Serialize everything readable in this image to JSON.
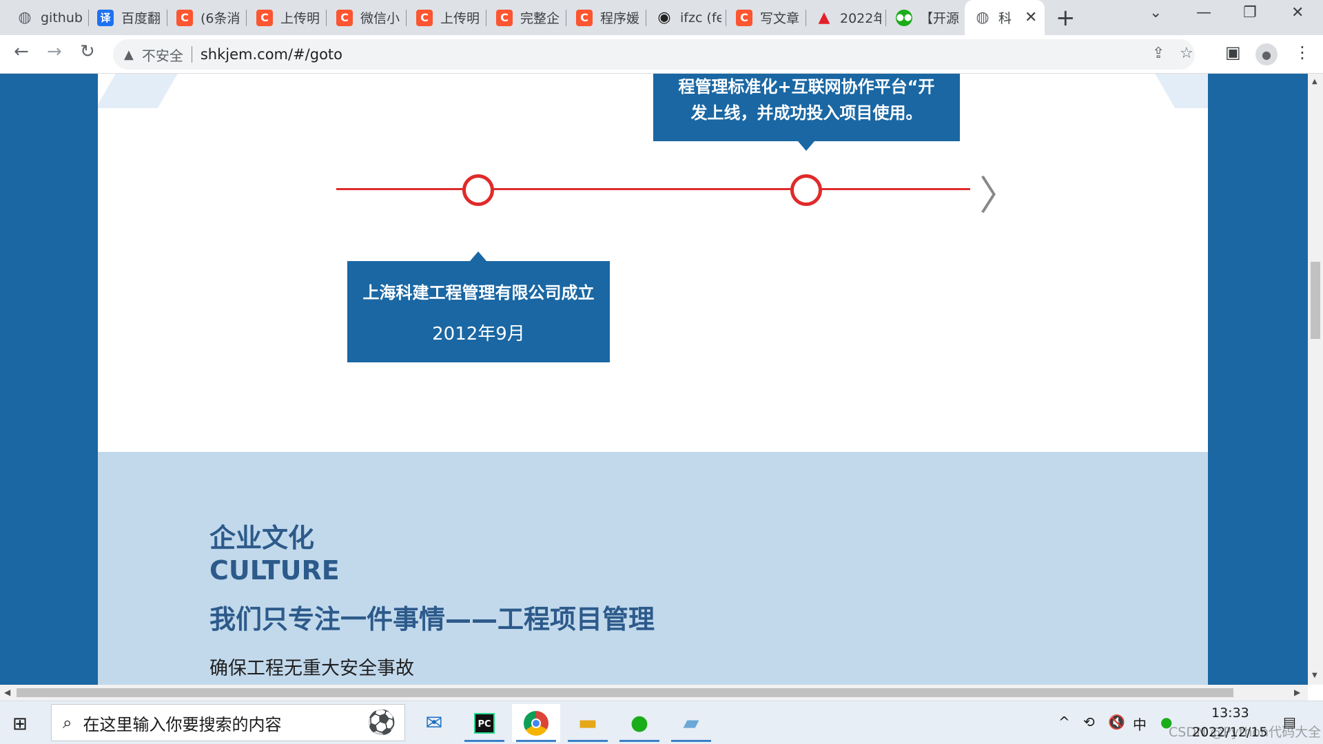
{
  "browser": {
    "tabs": [
      {
        "icon": "globe-icon",
        "glyph": "◍",
        "title": "github"
      },
      {
        "icon": "translate-icon",
        "glyph": "译",
        "title": "百度翻"
      },
      {
        "icon": "csdn-icon",
        "glyph": "C",
        "title": "(6条消"
      },
      {
        "icon": "csdn-icon",
        "glyph": "C",
        "title": "上传明"
      },
      {
        "icon": "csdn-icon",
        "glyph": "C",
        "title": "微信小"
      },
      {
        "icon": "csdn-icon",
        "glyph": "C",
        "title": "上传明"
      },
      {
        "icon": "csdn-icon",
        "glyph": "C",
        "title": "完整企"
      },
      {
        "icon": "csdn-icon",
        "glyph": "C",
        "title": "程序媛"
      },
      {
        "icon": "github-icon",
        "glyph": "◉",
        "title": "ifzc (fe"
      },
      {
        "icon": "csdn-icon",
        "glyph": "C",
        "title": "写文章"
      },
      {
        "icon": "adobe-icon",
        "glyph": "▲",
        "title": "2022年"
      },
      {
        "icon": "wechat-icon",
        "glyph": "●●",
        "title": "【开源"
      },
      {
        "icon": "globe-icon",
        "glyph": "◍",
        "title": "科"
      }
    ],
    "active_tab_index": 12,
    "new_tab_glyph": "+",
    "window_controls": {
      "dropdown": "⌄",
      "minimize": "—",
      "restore": "❐",
      "close": "✕"
    },
    "nav": {
      "back": "←",
      "forward": "→",
      "reload": "↻"
    },
    "security_label": "不安全",
    "url": "shkjem.com/#/goto"
  },
  "timeline": {
    "top_event": "程管理标准化+互联网协作平台“开发上线，并成功投入项目使用。",
    "top_event_line1": "程管理标准化+互联网协作平台“开",
    "top_event_line2": "发上线，并成功投入项目使用。",
    "bottom_event_title": "上海科建工程管理有限公司成立",
    "bottom_event_date": "2012年9月",
    "next_glyph": "〉",
    "line_color": "#e02a2a"
  },
  "culture": {
    "heading_cn": "企业文化",
    "heading_en": "CULTURE",
    "slogan": "我们只专注一件事情——工程项目管理",
    "item1": "确保工程无重大安全事故"
  },
  "taskbar": {
    "search_placeholder": "在这里输入你要搜索的内容",
    "apps": [
      "mail-app",
      "pycharm-app",
      "chrome-app",
      "file-explorer-app",
      "wechat-app",
      "notes-app"
    ],
    "tray": {
      "chevron": "^",
      "ime": "中"
    },
    "time": "13:33",
    "date": "2022/12/15",
    "watermark": "CSDN @Python代码大全"
  },
  "colors": {
    "brand_blue": "#1a67a3",
    "culture_bg": "#c2d9ec",
    "heading_blue": "#2c5a8a",
    "timeline_red": "#e02a2a"
  }
}
